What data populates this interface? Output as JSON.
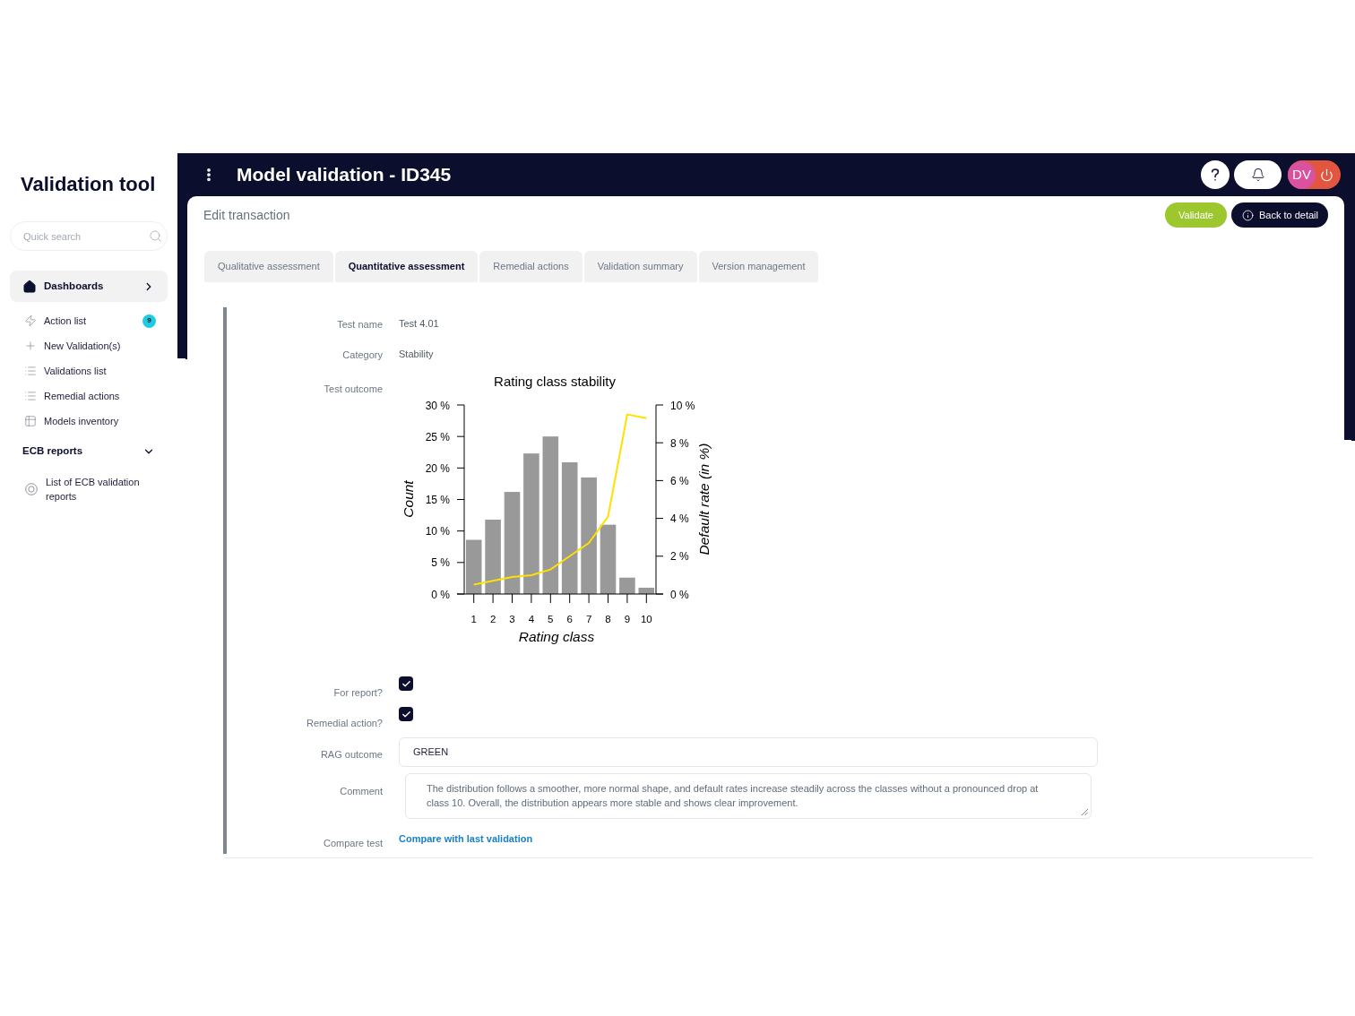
{
  "sidebar": {
    "title": "Validation tool",
    "search": {
      "placeholder": "Quick search"
    },
    "items": [
      {
        "kind": "group",
        "label": "Dashboards",
        "selected": true,
        "expanded": false
      },
      {
        "kind": "link",
        "label": "Action list",
        "selected": false,
        "badge": "9"
      },
      {
        "kind": "link",
        "label": "New Validation(s)",
        "selected": false
      },
      {
        "kind": "link",
        "label": "Validations list",
        "selected": false
      },
      {
        "kind": "link",
        "label": "Remedial actions",
        "selected": false
      },
      {
        "kind": "link",
        "label": "Models inventory",
        "selected": false
      },
      {
        "kind": "group",
        "label": "ECB reports",
        "selected": false,
        "expanded": true,
        "children": [
          {
            "label": "List of ECB validation reports",
            "selected": false
          }
        ]
      }
    ]
  },
  "header": {
    "title": "Model validation - ID345",
    "user": {
      "initials": "DV"
    }
  },
  "card": {
    "title": "Edit transaction",
    "actions": [
      {
        "kind": "primary",
        "label": "Validate"
      },
      {
        "kind": "secondary",
        "label": "Back to detail"
      }
    ]
  },
  "tabs": [
    {
      "label": "Qualitative assessment",
      "selected": false
    },
    {
      "label": "Quantitative assessment",
      "selected": true
    },
    {
      "label": "Remedial actions",
      "selected": false
    },
    {
      "label": "Validation summary",
      "selected": false
    },
    {
      "label": "Version management",
      "selected": false
    }
  ],
  "form": {
    "fields": [
      {
        "kind": "text",
        "label": "Test name",
        "value": "Test 4.01"
      },
      {
        "kind": "text",
        "label": "Category",
        "value": "Stability"
      },
      {
        "kind": "chart",
        "label": "Test outcome",
        "chart_data": {
          "type": "bar",
          "title": "Rating class stability",
          "xlabel": "Rating class",
          "ylabel": "Count",
          "y2label": "Default rate (in %)",
          "categories": [
            "1",
            "2",
            "3",
            "4",
            "5",
            "6",
            "7",
            "8",
            "9",
            "10"
          ],
          "series": [
            {
              "color": "#999999",
              "values": [
                8.6,
                11.8,
                16.2,
                22.3,
                25.0,
                20.9,
                18.5,
                11.0,
                2.6,
                1.0
              ]
            },
            {
              "type": "line",
              "axis": "y2",
              "color": "#ffe000",
              "values": [
                0.5,
                0.7,
                0.9,
                1.0,
                1.3,
                2.0,
                2.7,
                4.1,
                9.5,
                9.3
              ]
            }
          ],
          "ylim": [
            0,
            30
          ],
          "y2lim": [
            0,
            10
          ],
          "yticks": [
            {
              "value": 0,
              "label": "0 %"
            },
            {
              "value": 5,
              "label": "5 %"
            },
            {
              "value": 10,
              "label": "10 %"
            },
            {
              "value": 15,
              "label": "15 %"
            },
            {
              "value": 20,
              "label": "20 %"
            },
            {
              "value": 25,
              "label": "25 %"
            },
            {
              "value": 30,
              "label": "30 %"
            }
          ],
          "y2ticks": [
            {
              "value": 0,
              "label": "0 %"
            },
            {
              "value": 2,
              "label": "2 %"
            },
            {
              "value": 4,
              "label": "4 %"
            },
            {
              "value": 6,
              "label": "6 %"
            },
            {
              "value": 8,
              "label": "8 %"
            },
            {
              "value": 10,
              "label": "10 %"
            }
          ]
        }
      },
      {
        "kind": "checkbox",
        "label": "For report?",
        "checked": true
      },
      {
        "kind": "checkbox",
        "label": "Remedial action?",
        "checked": true
      },
      {
        "kind": "input",
        "label": "RAG outcome",
        "value": "GREEN"
      },
      {
        "kind": "textarea",
        "label": "Comment",
        "value": "The distribution follows a smoother, more normal shape, and default rates increase steadily across the classes without a pronounced drop at class 10. Overall, the distribution appears more stable and shows clear improvement."
      },
      {
        "kind": "link",
        "label": "Compare test",
        "value": "Compare with last validation"
      }
    ]
  }
}
